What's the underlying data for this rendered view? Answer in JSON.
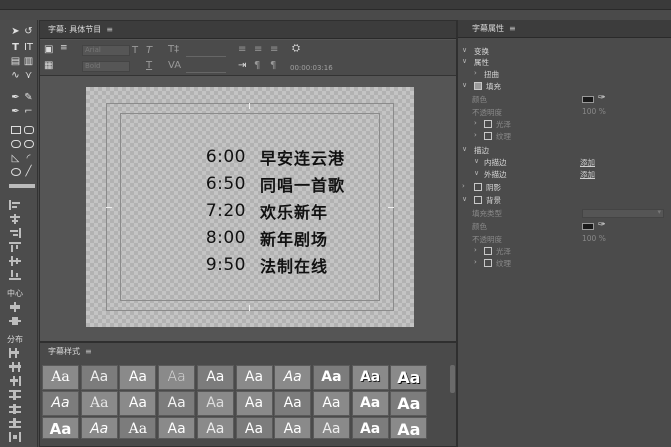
{
  "designer": {
    "title": "字幕: 具体节目",
    "menu_icon": "≡",
    "font_family": "Arial",
    "font_style": "Bold",
    "timecode": "00:00:03:16"
  },
  "schedule": [
    {
      "time": "6:00",
      "show": "早安连云港"
    },
    {
      "time": "6:50",
      "show": "同唱一首歌"
    },
    {
      "time": "7:20",
      "show": "欢乐新年"
    },
    {
      "time": "8:00",
      "show": "新年剧场"
    },
    {
      "time": "9:50",
      "show": "法制在线"
    }
  ],
  "tools": {
    "center_label": "中心",
    "distribute_label": "分布"
  },
  "styles": {
    "title": "字幕样式",
    "menu_icon": "≡",
    "sample": "Aa"
  },
  "props": {
    "title": "字幕属性",
    "menu_icon": "≡",
    "transform": "变换",
    "attributes": "属性",
    "distort": "扭曲",
    "fill": "填充",
    "fill_color": "颜色",
    "fill_opacity": "不透明度",
    "fill_opacity_val": "100 %",
    "gloss": "光泽",
    "texture": "纹理",
    "stroke": "描边",
    "inner_stroke": "内描边",
    "outer_stroke": "外描边",
    "add": "添加",
    "shadow": "阴影",
    "background": "背景",
    "fill_type": "填充类型",
    "bg_color": "颜色",
    "bg_opacity": "不透明度",
    "bg_opacity_val": "100 %",
    "bg_gloss": "光泽",
    "bg_texture": "纹理"
  }
}
